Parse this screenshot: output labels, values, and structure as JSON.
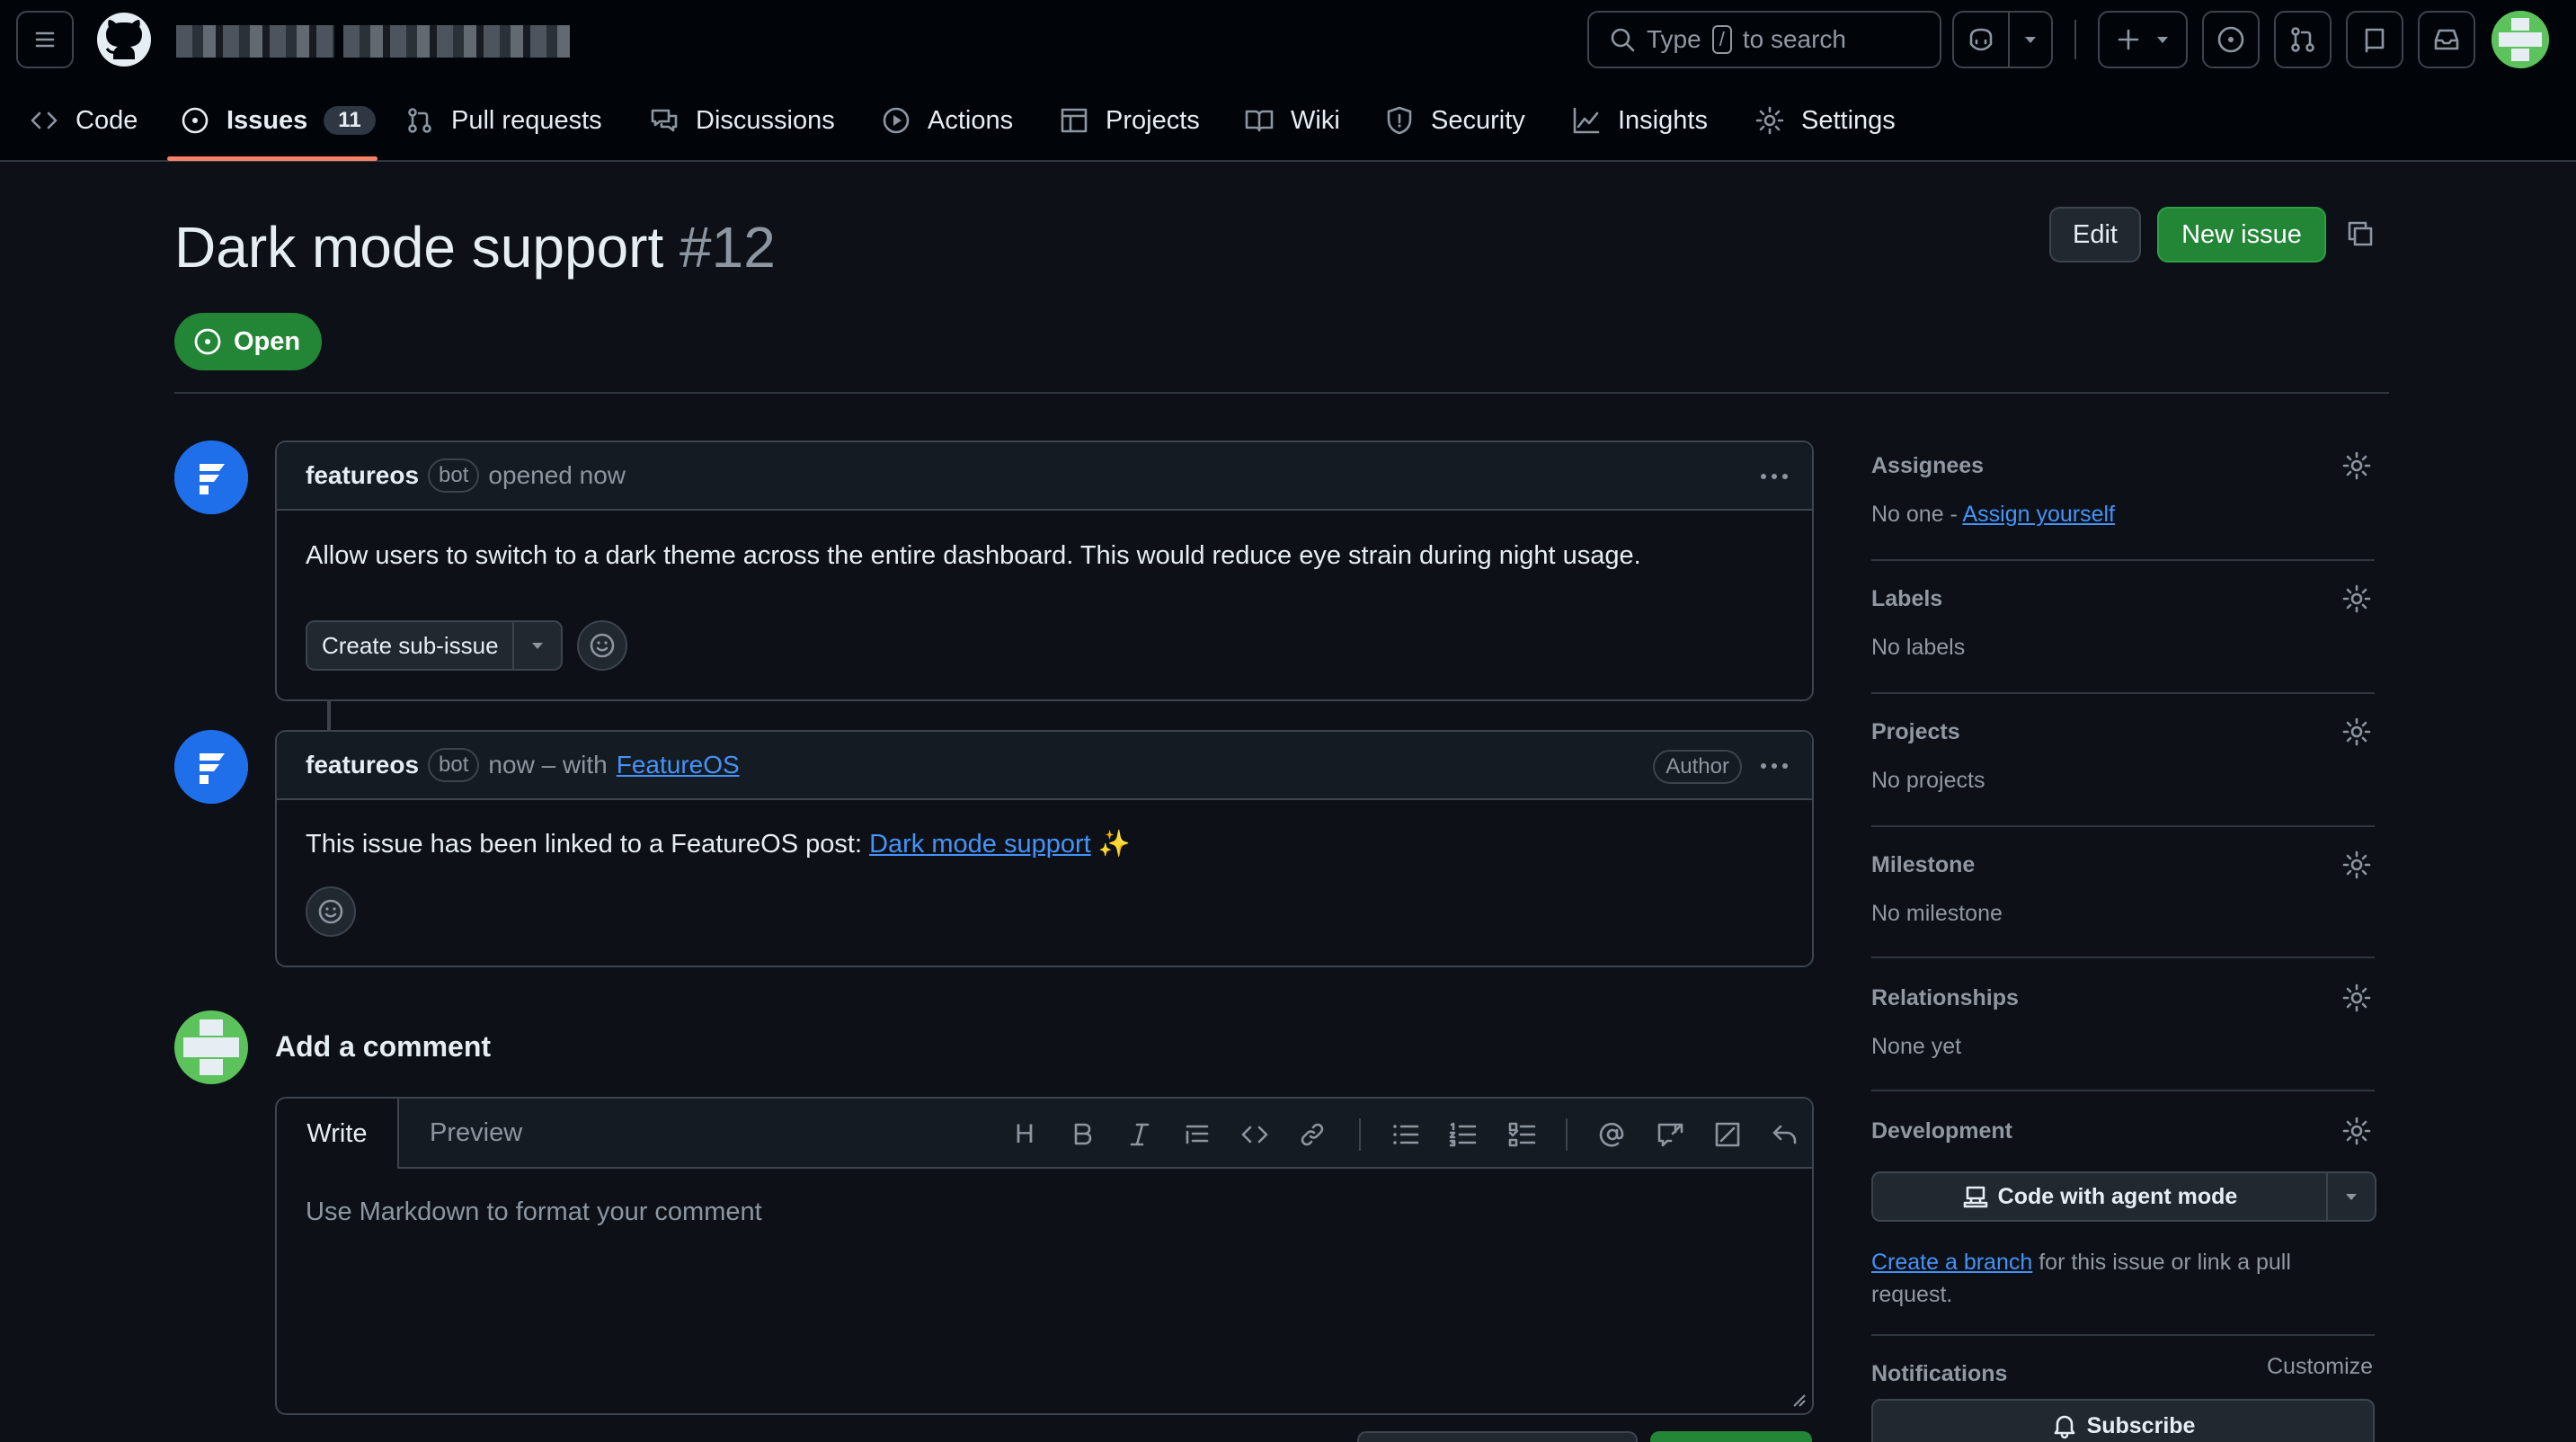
{
  "header": {
    "search_prefix": "Type",
    "search_key": "/",
    "search_suffix": "to search"
  },
  "nav": {
    "tabs": [
      {
        "label": "Code"
      },
      {
        "label": "Issues",
        "count": "11"
      },
      {
        "label": "Pull requests"
      },
      {
        "label": "Discussions"
      },
      {
        "label": "Actions"
      },
      {
        "label": "Projects"
      },
      {
        "label": "Wiki"
      },
      {
        "label": "Security"
      },
      {
        "label": "Insights"
      },
      {
        "label": "Settings"
      }
    ]
  },
  "issue": {
    "title": "Dark mode support",
    "number": "#12",
    "state": "Open",
    "edit_label": "Edit",
    "new_issue_label": "New issue"
  },
  "comments": [
    {
      "author": "featureos",
      "badge": "bot",
      "meta": "opened now",
      "body": "Allow users to switch to a dark theme across the entire dashboard. This would reduce eye strain during night usage.",
      "sub_issue_label": "Create sub-issue"
    },
    {
      "author": "featureos",
      "badge": "bot",
      "meta_prefix": "now – with",
      "meta_link": "FeatureOS",
      "author_badge": "Author",
      "body_prefix": "This issue has been linked to a FeatureOS post:",
      "body_link": "Dark mode support",
      "body_suffix": "✨"
    }
  ],
  "composer": {
    "title": "Add a comment",
    "tab_write": "Write",
    "tab_preview": "Preview",
    "placeholder": "Use Markdown to format your comment",
    "toolbar_heading": "H"
  },
  "sidebar": {
    "assignees": {
      "heading": "Assignees",
      "value_prefix": "No one -",
      "value_link": "Assign yourself"
    },
    "labels": {
      "heading": "Labels",
      "value": "No labels"
    },
    "projects": {
      "heading": "Projects",
      "value": "No projects"
    },
    "milestone": {
      "heading": "Milestone",
      "value": "No milestone"
    },
    "relationships": {
      "heading": "Relationships",
      "value": "None yet"
    },
    "development": {
      "heading": "Development",
      "agent_button": "Code with agent mode",
      "branch_link": "Create a branch",
      "branch_text_1": "for this issue or link a pull",
      "branch_text_2": "request."
    },
    "notifications": {
      "heading": "Notifications",
      "customize": "Customize",
      "subscribe": "Subscribe"
    }
  },
  "colors": {
    "background": "#0d1117",
    "header_background": "#010409",
    "accent_green": "#238636",
    "link_blue": "#4493f8",
    "tab_underline": "#f78166",
    "bot_avatar_blue": "#1f6feb",
    "user_avatar_green": "#5cc25c"
  }
}
